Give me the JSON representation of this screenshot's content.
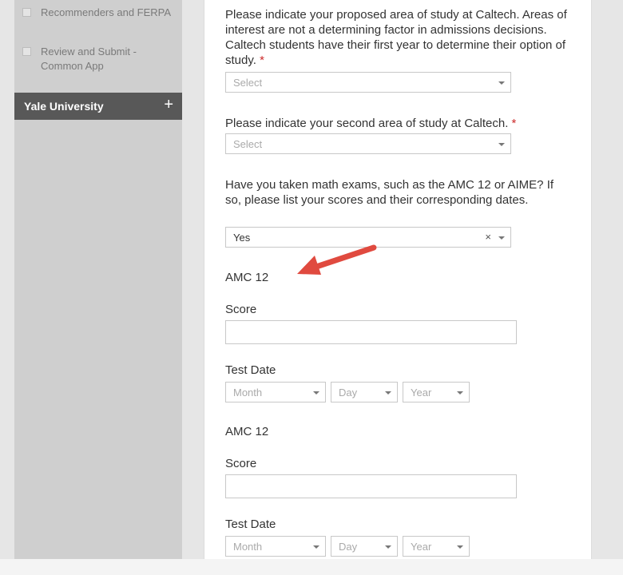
{
  "sidebar": {
    "items": [
      {
        "label": "Recommenders and FERPA"
      },
      {
        "label": "Review and Submit - Common App"
      }
    ],
    "section_header": {
      "label": "Yale University",
      "expand_symbol": "+"
    }
  },
  "form": {
    "q1": {
      "text": "Please indicate your proposed area of study at Caltech. Areas of interest are not a determining factor in admissions decisions. Caltech students have their first year to determine their option of study.",
      "required": "*",
      "select_placeholder": "Select"
    },
    "q2": {
      "text": "Please indicate your second area of study at Caltech.",
      "required": "*",
      "select_placeholder": "Select"
    },
    "q3": {
      "text": "Have you taken math exams, such as the AMC 12 or AIME? If so, please list your scores and their corresponding dates.",
      "select_value": "Yes",
      "clear_symbol": "×"
    },
    "exams": [
      {
        "title": "AMC 12",
        "score_label": "Score",
        "date_label": "Test Date",
        "month_placeholder": "Month",
        "day_placeholder": "Day",
        "year_placeholder": "Year"
      },
      {
        "title": "AMC 12",
        "score_label": "Score",
        "date_label": "Test Date",
        "month_placeholder": "Month",
        "day_placeholder": "Day",
        "year_placeholder": "Year"
      }
    ]
  },
  "colors": {
    "arrow": "#e04a3f",
    "required": "#cc2a2a",
    "sidebar_header": "#585858"
  }
}
